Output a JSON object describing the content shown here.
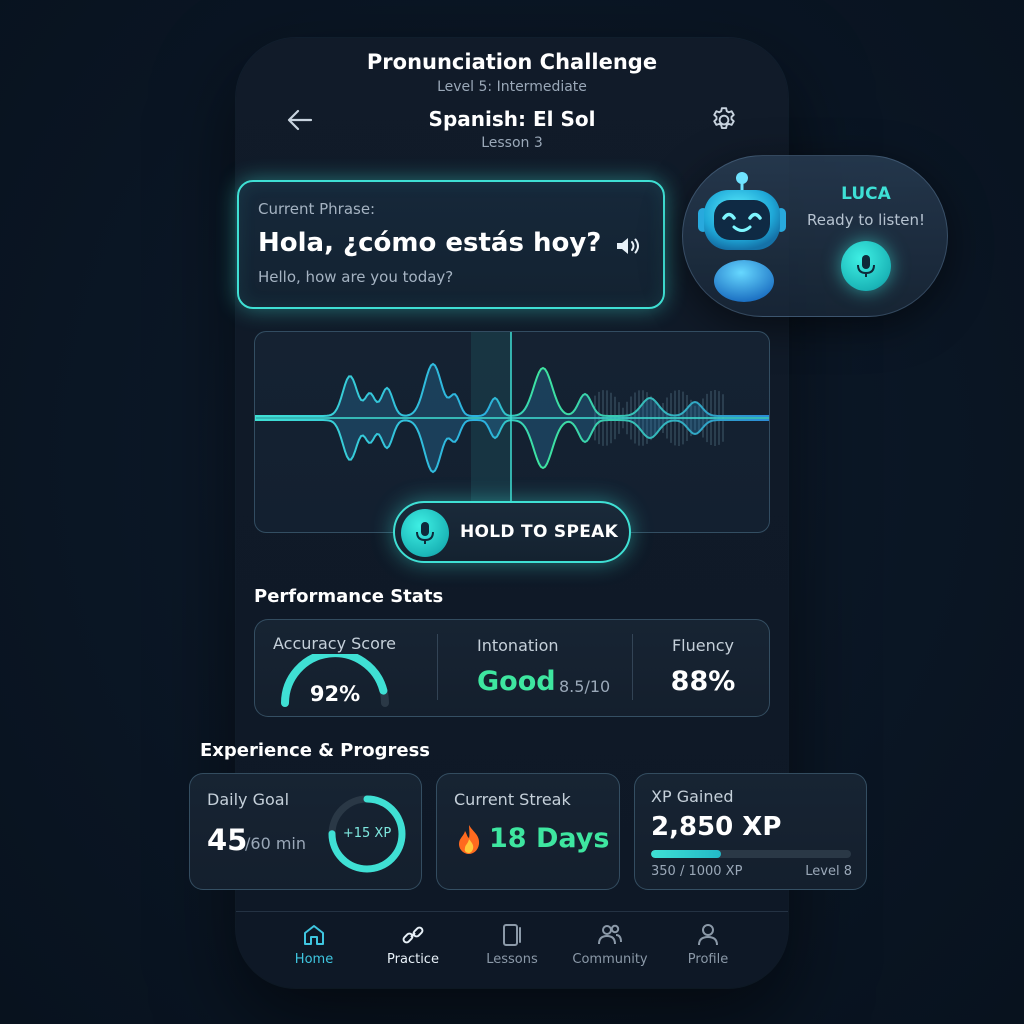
{
  "header": {
    "title": "Pronunciation Challenge",
    "subtitle": "Level 5: Intermediate",
    "lesson_title": "Spanish: El Sol",
    "lesson_subtitle": "Lesson 3"
  },
  "phrase": {
    "label": "Current Phrase:",
    "text": "Hola, ¿cómo estás hoy?",
    "translation": "Hello, how are you today?"
  },
  "assistant": {
    "name": "LUCA",
    "status": "Ready to listen!"
  },
  "recorder": {
    "button_label": "HOLD TO SPEAK"
  },
  "performance": {
    "title": "Performance Stats",
    "accuracy": {
      "label": "Accuracy Score",
      "value": "92%",
      "fraction": 0.92
    },
    "intonation": {
      "label": "Intonation",
      "value": "Good",
      "score": "8.5/10"
    },
    "fluency": {
      "label": "Fluency",
      "value": "88%"
    }
  },
  "experience": {
    "title": "Experience & Progress",
    "daily_goal": {
      "label": "Daily Goal",
      "value": "45",
      "unit": "/60 min",
      "ring_text": "+15 XP",
      "fraction": 0.75
    },
    "streak": {
      "label": "Current Streak",
      "value": "18 Days"
    },
    "xp": {
      "label": "XP Gained",
      "value": "2,850 XP",
      "progress_text": "350 / 1000 XP",
      "level": "Level 8",
      "fraction": 0.35
    }
  },
  "nav": {
    "items": [
      {
        "label": "Home",
        "icon": "home-icon",
        "active": true
      },
      {
        "label": "Practice",
        "icon": "practice-icon",
        "active": false
      },
      {
        "label": "Lessons",
        "icon": "lessons-icon",
        "active": false
      },
      {
        "label": "Community",
        "icon": "community-icon",
        "active": false
      },
      {
        "label": "Profile",
        "icon": "profile-icon",
        "active": false
      }
    ]
  },
  "colors": {
    "accent": "#3fe0d4",
    "accent_green": "#3ee6a0",
    "background": "#0b1726"
  }
}
